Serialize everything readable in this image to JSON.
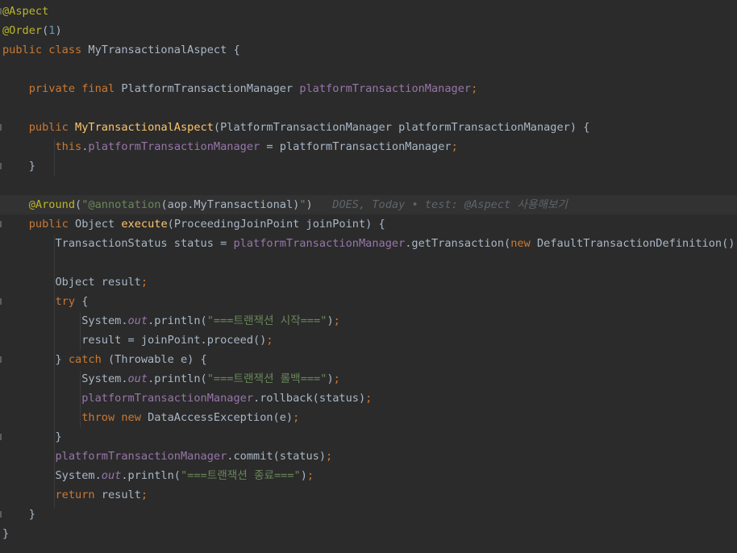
{
  "editor": {
    "colors": {
      "background": "#2b2b2b",
      "highlight_line": "#323232",
      "annotation": "#bbb529",
      "keyword": "#cc7832",
      "number": "#6897bb",
      "string": "#6a8759",
      "field": "#9876aa",
      "method": "#ffc66d",
      "default": "#a9b7c6",
      "inline_blame": "#5f6469"
    },
    "lines": [
      {
        "fold": true,
        "tokens": [
          {
            "c": "ann",
            "t": "@Aspect"
          }
        ]
      },
      {
        "fold": false,
        "tokens": [
          {
            "c": "ann",
            "t": "@Order"
          },
          {
            "c": "def",
            "t": "("
          },
          {
            "c": "num",
            "t": "1"
          },
          {
            "c": "def",
            "t": ")"
          }
        ]
      },
      {
        "fold": false,
        "tokens": [
          {
            "c": "kw",
            "t": "public class "
          },
          {
            "c": "def",
            "t": "MyTransactionalAspect {"
          }
        ]
      },
      {
        "fold": false,
        "tokens": []
      },
      {
        "fold": false,
        "tokens": [
          {
            "c": "def",
            "t": "    "
          },
          {
            "c": "kw",
            "t": "private final "
          },
          {
            "c": "def",
            "t": "PlatformTransactionManager "
          },
          {
            "c": "field",
            "t": "platformTransactionManager"
          },
          {
            "c": "kw",
            "t": ";"
          }
        ]
      },
      {
        "fold": false,
        "tokens": []
      },
      {
        "fold": true,
        "tokens": [
          {
            "c": "def",
            "t": "    "
          },
          {
            "c": "kw",
            "t": "public "
          },
          {
            "c": "meth",
            "t": "MyTransactionalAspect"
          },
          {
            "c": "def",
            "t": "(PlatformTransactionManager platformTransactionManager) {"
          }
        ]
      },
      {
        "fold": false,
        "tokens": [
          {
            "c": "def",
            "t": "        "
          },
          {
            "c": "kw",
            "t": "this"
          },
          {
            "c": "def",
            "t": "."
          },
          {
            "c": "field",
            "t": "platformTransactionManager"
          },
          {
            "c": "def",
            "t": " = platformTransactionManager"
          },
          {
            "c": "kw",
            "t": ";"
          }
        ]
      },
      {
        "fold": true,
        "tokens": [
          {
            "c": "def",
            "t": "    }"
          }
        ]
      },
      {
        "fold": false,
        "tokens": []
      },
      {
        "fold": false,
        "highlight": true,
        "tokens": [
          {
            "c": "def",
            "t": "    "
          },
          {
            "c": "ann",
            "t": "@Around"
          },
          {
            "c": "def",
            "t": "("
          },
          {
            "c": "str",
            "t": "\"@annotation"
          },
          {
            "c": "def",
            "t": "(aop.MyTransactional)"
          },
          {
            "c": "str",
            "t": "\""
          },
          {
            "c": "def",
            "t": ")"
          },
          {
            "c": "blame",
            "t": "   DOES, Today • test: @Aspect 사용해보기"
          }
        ]
      },
      {
        "fold": true,
        "tokens": [
          {
            "c": "def",
            "t": "    "
          },
          {
            "c": "kw",
            "t": "public "
          },
          {
            "c": "def",
            "t": "Object "
          },
          {
            "c": "meth",
            "t": "execute"
          },
          {
            "c": "def",
            "t": "(ProceedingJoinPoint joinPoint) {"
          }
        ]
      },
      {
        "fold": false,
        "tokens": [
          {
            "c": "def",
            "t": "        TransactionStatus status = "
          },
          {
            "c": "field",
            "t": "platformTransactionManager"
          },
          {
            "c": "def",
            "t": ".getTransaction("
          },
          {
            "c": "kw",
            "t": "new "
          },
          {
            "c": "def",
            "t": "DefaultTransactionDefinition())"
          },
          {
            "c": "kw",
            "t": ";"
          }
        ]
      },
      {
        "fold": false,
        "tokens": []
      },
      {
        "fold": false,
        "tokens": [
          {
            "c": "def",
            "t": "        Object result"
          },
          {
            "c": "kw",
            "t": ";"
          }
        ]
      },
      {
        "fold": true,
        "tokens": [
          {
            "c": "def",
            "t": "        "
          },
          {
            "c": "kw",
            "t": "try "
          },
          {
            "c": "def",
            "t": "{"
          }
        ]
      },
      {
        "fold": false,
        "tokens": [
          {
            "c": "def",
            "t": "            System."
          },
          {
            "c": "ital",
            "t": "out"
          },
          {
            "c": "def",
            "t": ".println("
          },
          {
            "c": "str",
            "t": "\"===트랜잭션 시작===\""
          },
          {
            "c": "def",
            "t": ")"
          },
          {
            "c": "kw",
            "t": ";"
          }
        ]
      },
      {
        "fold": false,
        "tokens": [
          {
            "c": "def",
            "t": "            result = joinPoint.proceed()"
          },
          {
            "c": "kw",
            "t": ";"
          }
        ]
      },
      {
        "fold": true,
        "tokens": [
          {
            "c": "def",
            "t": "        } "
          },
          {
            "c": "kw",
            "t": "catch "
          },
          {
            "c": "def",
            "t": "(Throwable e) {"
          }
        ]
      },
      {
        "fold": false,
        "tokens": [
          {
            "c": "def",
            "t": "            System."
          },
          {
            "c": "ital",
            "t": "out"
          },
          {
            "c": "def",
            "t": ".println("
          },
          {
            "c": "str",
            "t": "\"===트랜잭션 롤백===\""
          },
          {
            "c": "def",
            "t": ")"
          },
          {
            "c": "kw",
            "t": ";"
          }
        ]
      },
      {
        "fold": false,
        "tokens": [
          {
            "c": "def",
            "t": "            "
          },
          {
            "c": "field",
            "t": "platformTransactionManager"
          },
          {
            "c": "def",
            "t": ".rollback(status)"
          },
          {
            "c": "kw",
            "t": ";"
          }
        ]
      },
      {
        "fold": false,
        "tokens": [
          {
            "c": "def",
            "t": "            "
          },
          {
            "c": "kw",
            "t": "throw new "
          },
          {
            "c": "def",
            "t": "DataAccessException(e)"
          },
          {
            "c": "kw",
            "t": ";"
          }
        ]
      },
      {
        "fold": true,
        "tokens": [
          {
            "c": "def",
            "t": "        }"
          }
        ]
      },
      {
        "fold": false,
        "tokens": [
          {
            "c": "def",
            "t": "        "
          },
          {
            "c": "field",
            "t": "platformTransactionManager"
          },
          {
            "c": "def",
            "t": ".commit(status)"
          },
          {
            "c": "kw",
            "t": ";"
          }
        ]
      },
      {
        "fold": false,
        "tokens": [
          {
            "c": "def",
            "t": "        System."
          },
          {
            "c": "ital",
            "t": "out"
          },
          {
            "c": "def",
            "t": ".println("
          },
          {
            "c": "str",
            "t": "\"===트랜잭션 종료===\""
          },
          {
            "c": "def",
            "t": ")"
          },
          {
            "c": "kw",
            "t": ";"
          }
        ]
      },
      {
        "fold": false,
        "tokens": [
          {
            "c": "def",
            "t": "        "
          },
          {
            "c": "kw",
            "t": "return "
          },
          {
            "c": "def",
            "t": "result"
          },
          {
            "c": "kw",
            "t": ";"
          }
        ]
      },
      {
        "fold": true,
        "tokens": [
          {
            "c": "def",
            "t": "    }"
          }
        ]
      },
      {
        "fold": false,
        "tokens": [
          {
            "c": "def",
            "t": "}"
          }
        ]
      }
    ]
  }
}
